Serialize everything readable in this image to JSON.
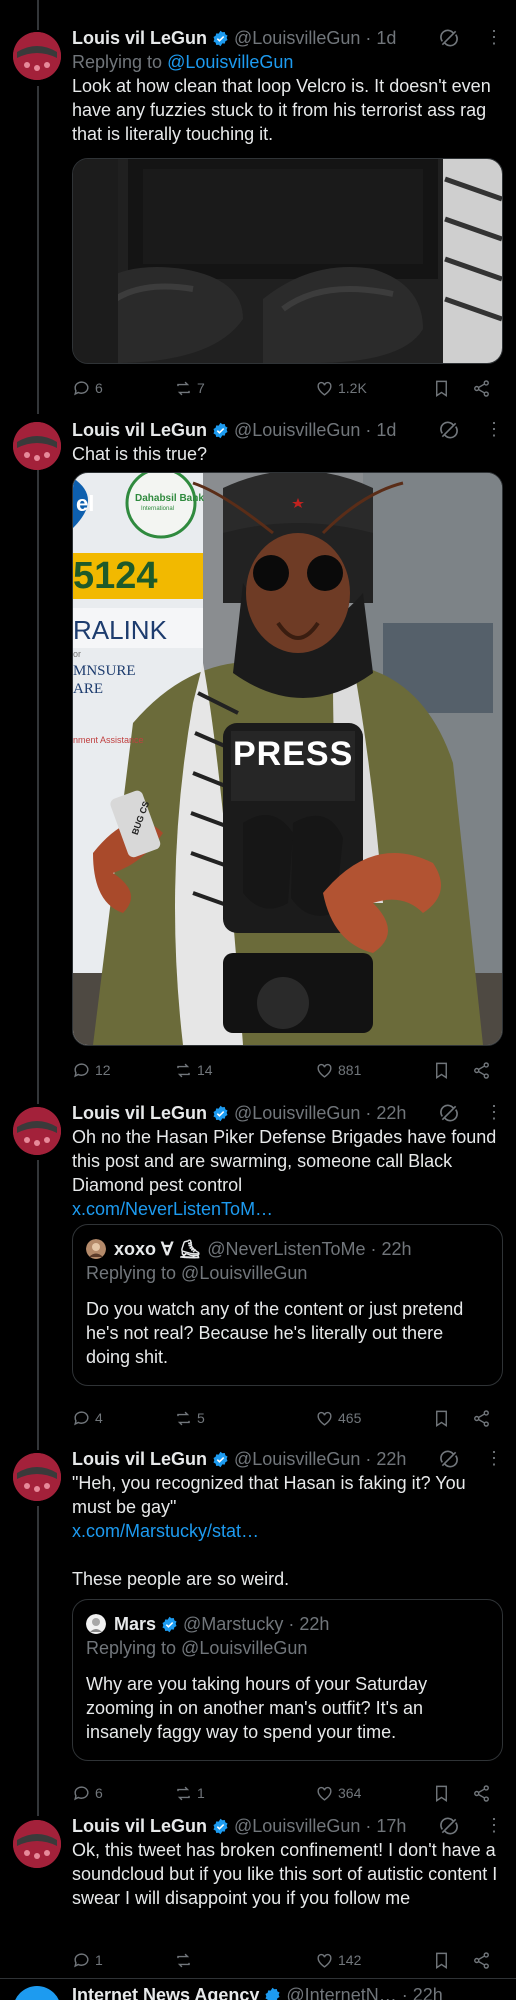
{
  "author": {
    "name": "Louis vil LeGun",
    "handle": "@LouisvilleGun"
  },
  "tweets": [
    {
      "time": "· 1d",
      "replying_prefix": "Replying to ",
      "replying_handle": "@LouisvilleGun",
      "text": "Look at how clean that loop Velcro is. It doesn't even have any fuzzies stuck to it from his terrorist ass rag that is literally touching it.",
      "stats": {
        "replies": "6",
        "reposts": "7",
        "likes": "1.2K"
      }
    },
    {
      "time": "· 1d",
      "text": "Chat is this true?",
      "media_text": {
        "bank_name": "Dahabsil Bank",
        "bank_sub": "International",
        "bank_partial": "el",
        "number": "5124",
        "banner_1": "RALINK",
        "banner_2": "or",
        "banner_3": "MNSURE",
        "banner_4": "ARE",
        "banner_5": "nment Assistance",
        "vest_label": "PRESS",
        "can_label": "BUG CS"
      },
      "stats": {
        "replies": "12",
        "reposts": "14",
        "likes": "881"
      }
    },
    {
      "time": "· 22h",
      "text": "Oh no the Hasan Piker Defense Brigades have found this post and are swarming, someone call Black Diamond pest control",
      "link": "x.com/NeverListenToM…",
      "quote": {
        "name": "xoxo ∀ ⛸",
        "handle": "@NeverListenToMe",
        "time": "· 22h",
        "replying": "Replying to @LouisvilleGun",
        "text": "Do you watch any of the content or just pretend he's not real? Because he's literally out there doing shit."
      },
      "stats": {
        "replies": "4",
        "reposts": "5",
        "likes": "465"
      }
    },
    {
      "time": "· 22h",
      "text": "\"Heh, you recognized that Hasan is faking it? You must be gay\"",
      "link": "x.com/Marstucky/stat…",
      "text2": "These people are so weird.",
      "quote": {
        "name": "Mars",
        "handle": "@Marstucky",
        "time": "· 22h",
        "replying": "Replying to @LouisvilleGun",
        "text": "Why are you taking hours of your Saturday zooming in on another man's outfit? It's an insanely faggy way to spend your time."
      },
      "stats": {
        "replies": "6",
        "reposts": "1",
        "likes": "364"
      }
    },
    {
      "time": "· 17h",
      "text": "Ok, this tweet has broken confinement! I don't have a soundcloud but if you like this sort of autistic content I swear I will disappoint you if you follow me",
      "stats": {
        "replies": "1",
        "reposts": "",
        "likes": "142"
      }
    }
  ],
  "next_tweet": {
    "name": "Internet News Agency",
    "handle": "@InternetN…",
    "time": "· 22h"
  },
  "colors": {
    "background": "#000000",
    "text": "#e7e9ea",
    "muted": "#71767b",
    "accent": "#1d9bf0",
    "border": "#2f3336"
  }
}
